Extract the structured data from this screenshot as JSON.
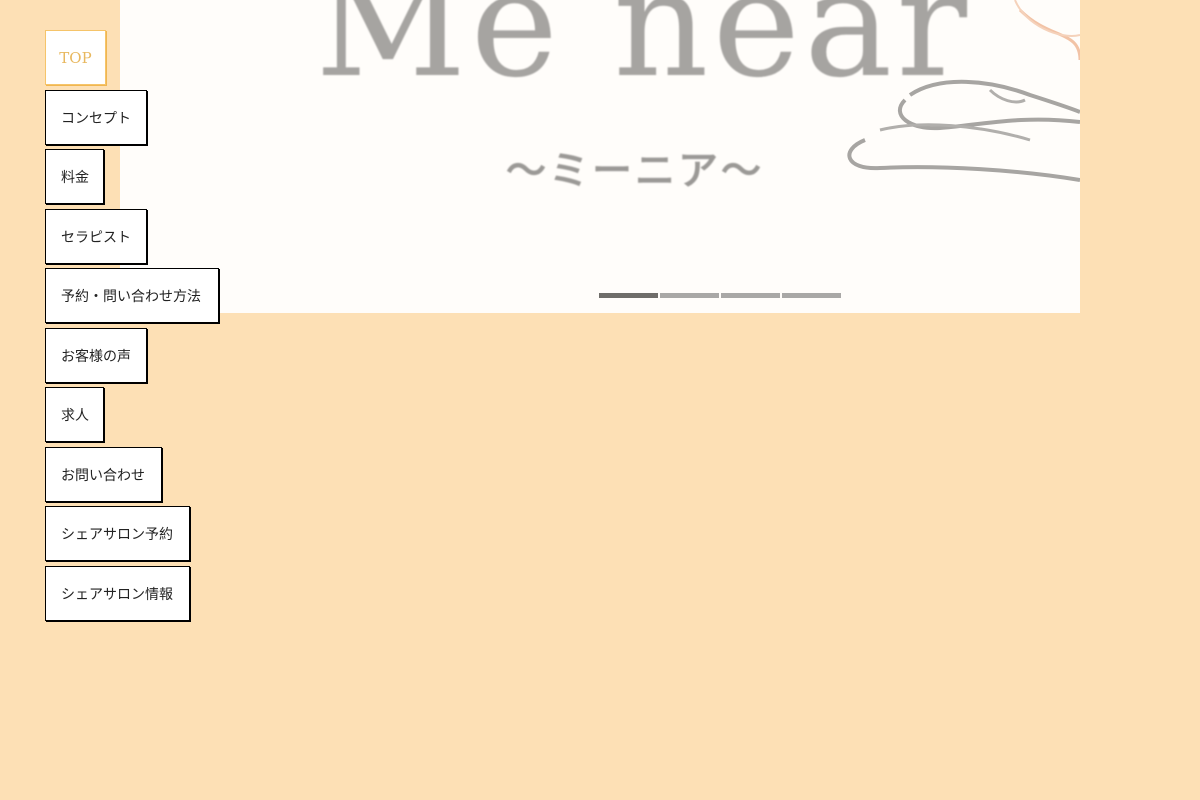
{
  "hero": {
    "logo_latin": "Me near",
    "logo_kana": "〜ミーニア〜",
    "slides": 4,
    "active_slide": 1
  },
  "nav": {
    "items": [
      {
        "label": "TOP",
        "active": true
      },
      {
        "label": "コンセプト",
        "active": false
      },
      {
        "label": "料金",
        "active": false
      },
      {
        "label": "セラピスト",
        "active": false
      },
      {
        "label": "予約・問い合わせ方法",
        "active": false
      },
      {
        "label": "お客様の声",
        "active": false
      },
      {
        "label": "求人",
        "active": false
      },
      {
        "label": "お問い合わせ",
        "active": false
      },
      {
        "label": "シェアサロン予約",
        "active": false
      },
      {
        "label": "シェアサロン情報",
        "active": false
      }
    ]
  },
  "colors": {
    "page_background": "#fde0b5",
    "hero_background": "#fffdfa",
    "active_accent": "#f5c46a",
    "indicator_active": "#6f6d69",
    "indicator_inactive": "#a9a8a6"
  }
}
